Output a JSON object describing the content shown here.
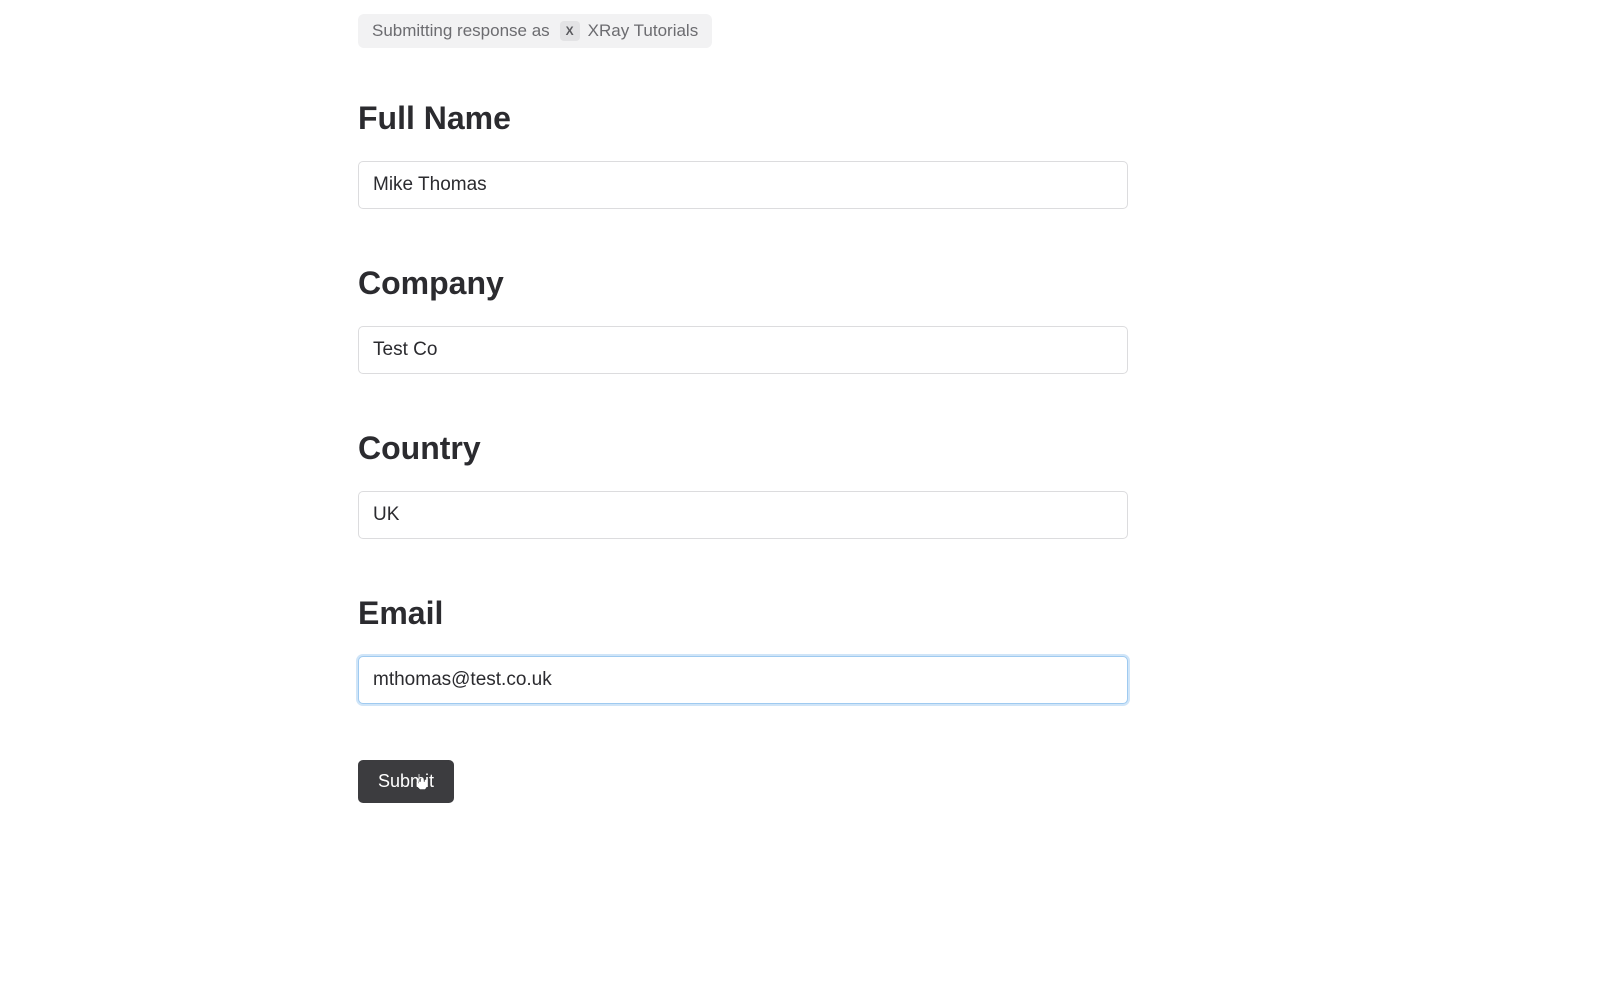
{
  "identity_pill": {
    "prefix": "Submitting response as",
    "close_glyph": "X",
    "name": "XRay Tutorials"
  },
  "fields": {
    "full_name": {
      "label": "Full Name",
      "value": "Mike Thomas"
    },
    "company": {
      "label": "Company",
      "value": "Test Co"
    },
    "country": {
      "label": "Country",
      "value": "UK"
    },
    "email": {
      "label": "Email",
      "value": "mthomas@test.co.uk"
    }
  },
  "submit_label": "Submit"
}
